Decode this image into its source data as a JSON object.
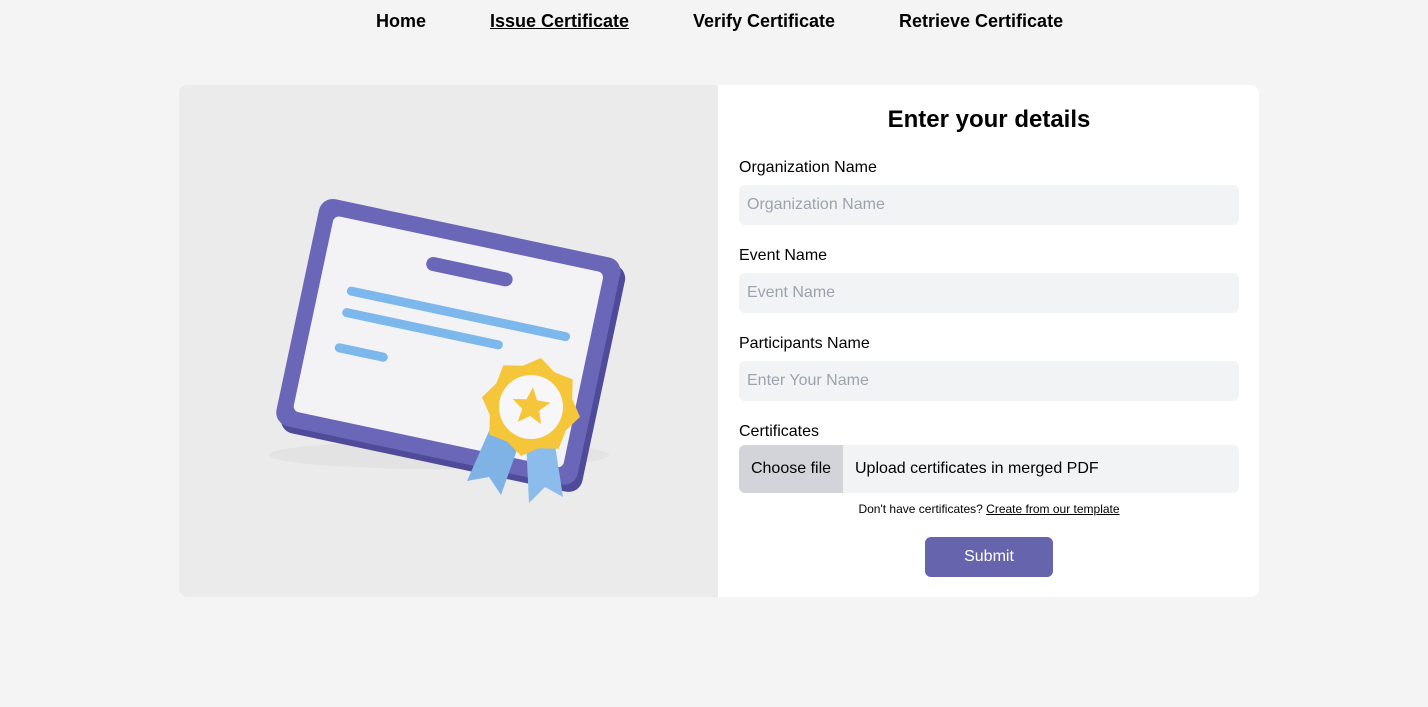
{
  "nav": {
    "items": [
      {
        "label": "Home"
      },
      {
        "label": "Issue Certificate"
      },
      {
        "label": "Verify Certificate"
      },
      {
        "label": "Retrieve Certificate"
      }
    ],
    "active": "Issue Certificate"
  },
  "illustration": {
    "icon": "certificate-illustration",
    "colors": {
      "frame": "#6a66b8",
      "paper": "#f3f3f6",
      "line": "#7cb8ec",
      "medal": "#f5c53a",
      "ribbon": "#7fb3e6"
    }
  },
  "form": {
    "title": "Enter your details",
    "fields": [
      {
        "label": "Organization Name",
        "placeholder": "Organization Name",
        "value": ""
      },
      {
        "label": "Event Name",
        "placeholder": "Event Name",
        "value": ""
      },
      {
        "label": "Participants Name",
        "placeholder": "Enter Your Name",
        "value": ""
      }
    ],
    "certificates": {
      "label": "Certificates",
      "button_label": "Choose file",
      "text": "Upload certificates in merged PDF"
    },
    "note": {
      "text": "Don't have certificates?",
      "link": "Create from our template"
    },
    "submit_label": "Submit"
  },
  "colors": {
    "page_bg": "#f4f4f4",
    "accent": "#6764ae",
    "input_bg": "#f2f3f5",
    "file_button_bg": "#d3d4d9"
  }
}
